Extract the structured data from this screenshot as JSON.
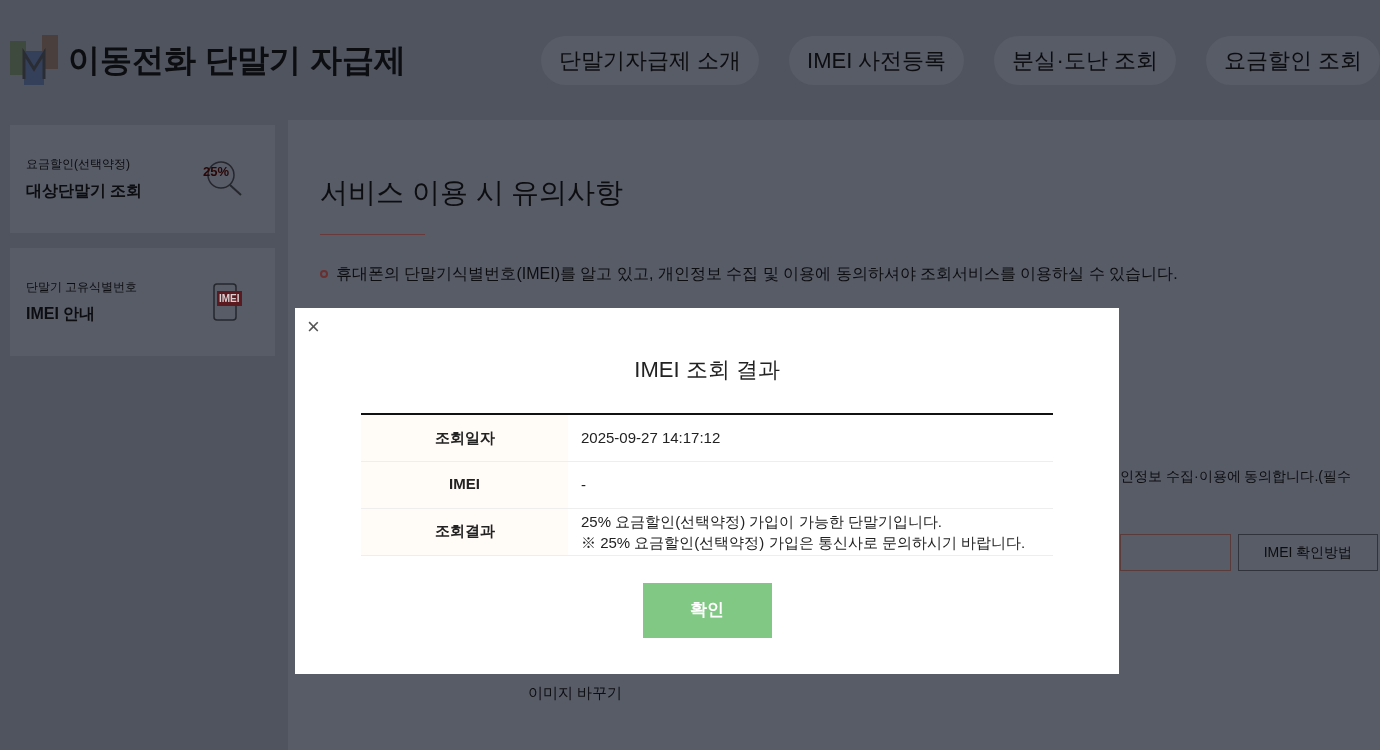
{
  "header": {
    "logo_text": "이동전화 단말기 자급제",
    "nav": [
      {
        "label": "단말기자급제 소개"
      },
      {
        "label": "IMEI 사전등록"
      },
      {
        "label": "분실·도난 조회"
      },
      {
        "label": "요금할인 조회"
      }
    ]
  },
  "sidebar": {
    "items": [
      {
        "kind": "search",
        "subtitle": "요금할인(선택약정)",
        "title": "대상단말기 조회",
        "icon_text": "25%"
      },
      {
        "kind": "phone",
        "subtitle": "단말기 고유식별번호",
        "title": "IMEI 안내",
        "icon_text": "IMEI"
      }
    ]
  },
  "main": {
    "title": "서비스 이용 시 유의사항",
    "notice": "휴대폰의 단말기식별번호(IMEI)를 알고 있고, 개인정보 수집 및 이용에 동의하셔야 조회서비스를 이용하실 수 있습니다.",
    "consent_text": "인정보 수집·이용에 동의합니다.(필수",
    "help_button": "IMEI 확인방법",
    "image_button": "이미지 바꾸기"
  },
  "modal": {
    "close": "×",
    "title": "IMEI 조회 결과",
    "rows": [
      {
        "label": "조회일자",
        "lines": [
          "2025-09-27 14:17:12"
        ]
      },
      {
        "label": "IMEI",
        "lines": [
          "-"
        ]
      },
      {
        "label": "조회결과",
        "lines": [
          "25% 요금할인(선택약정) 가입이 가능한 단말기입니다.",
          "※ 25% 요금할인(선택약정) 가입은 통신사로 문의하시기 바랍니다."
        ]
      }
    ],
    "confirm": "확인"
  }
}
